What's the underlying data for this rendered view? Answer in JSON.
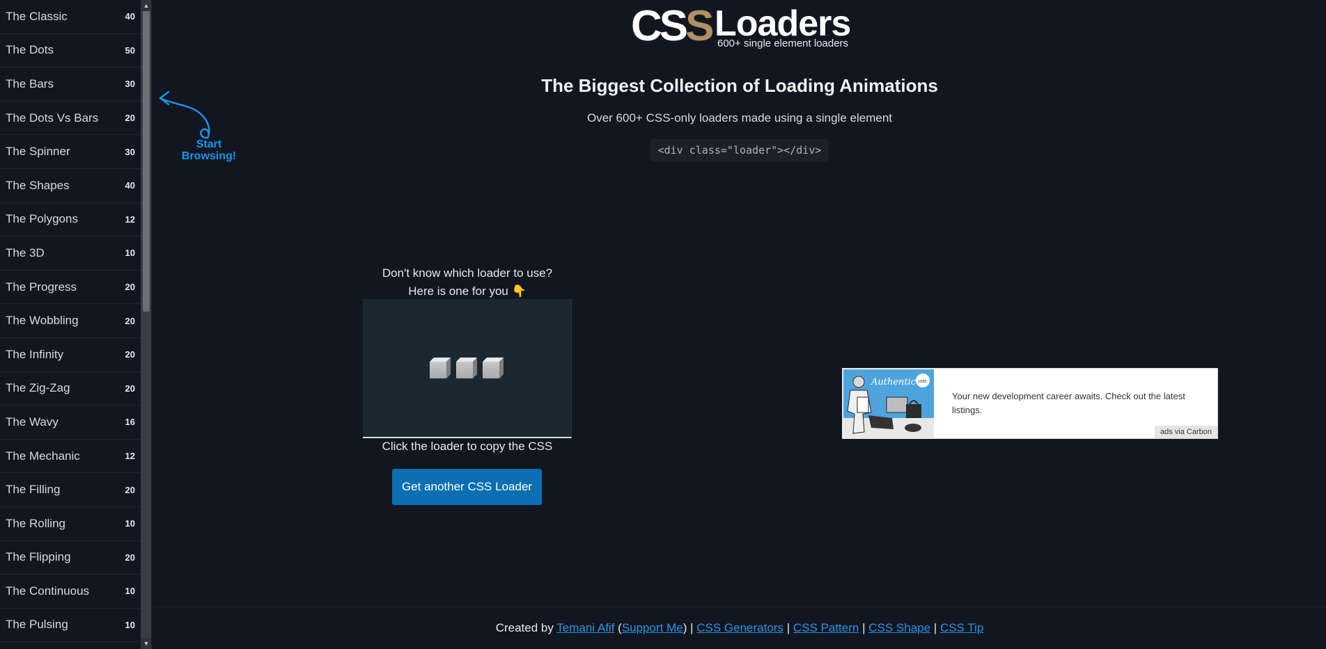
{
  "sidebar": {
    "items": [
      {
        "label": "The Classic",
        "count": "40"
      },
      {
        "label": "The Dots",
        "count": "50"
      },
      {
        "label": "The Bars",
        "count": "30"
      },
      {
        "label": "The Dots Vs Bars",
        "count": "20"
      },
      {
        "label": "The Spinner",
        "count": "30"
      },
      {
        "label": "The Shapes",
        "count": "40"
      },
      {
        "label": "The Polygons",
        "count": "12"
      },
      {
        "label": "The 3D",
        "count": "10"
      },
      {
        "label": "The Progress",
        "count": "20"
      },
      {
        "label": "The Wobbling",
        "count": "20"
      },
      {
        "label": "The Infinity",
        "count": "20"
      },
      {
        "label": "The Zig-Zag",
        "count": "20"
      },
      {
        "label": "The Wavy",
        "count": "16"
      },
      {
        "label": "The Mechanic",
        "count": "12"
      },
      {
        "label": "The Filling",
        "count": "20"
      },
      {
        "label": "The Rolling",
        "count": "10"
      },
      {
        "label": "The Flipping",
        "count": "20"
      },
      {
        "label": "The Continuous",
        "count": "10"
      },
      {
        "label": "The Pulsing",
        "count": "10"
      }
    ]
  },
  "callout": {
    "line1": "Start",
    "line2": "Browsing!"
  },
  "logo": {
    "css_c": "C",
    "css_s1": "S",
    "css_s2": "S",
    "word": "Loaders",
    "tagline": "600+ single element loaders"
  },
  "hero": {
    "title": "The Biggest Collection of Loading Animations",
    "subtitle": "Over 600+ CSS-only loaders made using a single element",
    "code": "<div class=\"loader\"></div>"
  },
  "random_loader": {
    "prompt_line1": "Don't know which loader to use?",
    "prompt_line2": "Here is one for you 👇",
    "copy_hint": "Click the loader to copy the CSS",
    "button_label": "Get another CSS Loader"
  },
  "ad": {
    "text": "Your new development career awaits. Check out the latest listings.",
    "via": "ads via Carbon",
    "image_brand": "Authentic",
    "image_badge": "JOBS"
  },
  "footer": {
    "prefix": "Created by ",
    "author": "Temani Afif",
    "paren_open": " (",
    "support": "Support Me",
    "paren_close": ") | ",
    "links": [
      "CSS Generators",
      "CSS Pattern",
      "CSS Shape",
      "CSS Tip"
    ],
    "sep": " | "
  },
  "colors": {
    "background": "#121620",
    "accent": "#0c6fb1",
    "link": "#2b95e6",
    "logo_s": "#b08f63"
  }
}
